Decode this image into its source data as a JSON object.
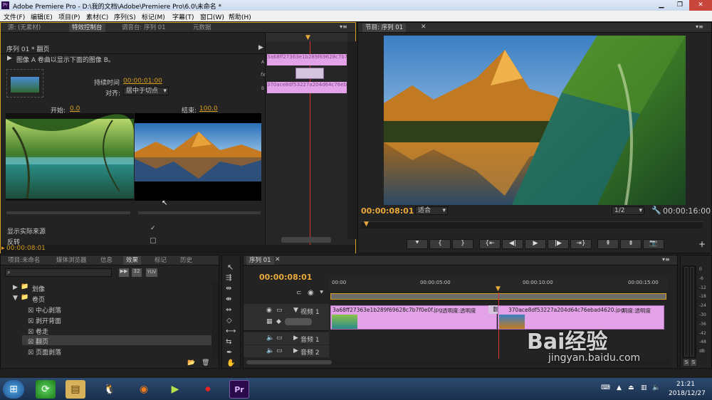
{
  "window": {
    "title": "Adobe Premiere Pro - D:\\我的文档\\Adobe\\Premiere Pro\\6.0\\未命名 *",
    "icon": "Pr"
  },
  "menu": [
    "文件(F)",
    "编辑(E)",
    "项目(P)",
    "素材(C)",
    "序列(S)",
    "标记(M)",
    "字幕(T)",
    "窗口(W)",
    "帮助(H)"
  ],
  "effect_panel": {
    "tabs": [
      "源: (无素材)",
      "特效控制台",
      "调音台: 序列 01",
      "元数据"
    ],
    "sequence_label": "序列 01 * 翻页",
    "description": "图像 A 卷曲以显示下面的图像 B。",
    "duration_label": "持续时间",
    "duration_value": "00:00:01:00",
    "align_label": "对齐:",
    "align_value": "居中于切点",
    "start_label": "开始:",
    "start_value": "0.0",
    "end_label": "结束:",
    "end_value": "100.0",
    "show_source_label": "显示实际来源",
    "reverse_label": "反转",
    "timecode": "00:00:08:01",
    "clip_a_name": "3a68ff27363e1b289f69628c7b7f0e0f.jpg",
    "clip_b_name": "370ace8df53227a204d64c76ebad4620.jpg",
    "label_a": "A",
    "label_b": "B",
    "fx": "fx"
  },
  "program_monitor": {
    "tab": "节目: 序列 01",
    "timecode": "00:00:08:01",
    "fit": "适合",
    "resolution": "1/2",
    "duration": "00:00:16:00"
  },
  "project_panel": {
    "tabs": [
      "项目:未命名",
      "媒体浏览器",
      "信息",
      "效果",
      "标记",
      "历史"
    ],
    "badges": [
      "32",
      "YUV"
    ],
    "folders": [
      {
        "name": "划像",
        "expanded": false
      },
      {
        "name": "卷页",
        "expanded": true
      }
    ],
    "items": [
      "中心剥落",
      "剥开背面",
      "卷走",
      "翻页",
      "页面剥落"
    ],
    "selected": "翻页"
  },
  "timeline": {
    "tab": "序列 01",
    "timecode": "00:00:08:01",
    "ruler": [
      "00:00",
      "00:00:05:00",
      "00:00:10:00",
      "00:00:15:00"
    ],
    "tracks": [
      {
        "name": "视频 1",
        "type": "video"
      },
      {
        "name": "音频 1",
        "type": "audio"
      },
      {
        "name": "音频 2",
        "type": "audio"
      }
    ],
    "clip1": {
      "name": "3a68ff27363e1b289f69628c7b7f0e0f.jpg",
      "fx": "透明度:透明度"
    },
    "transition": "翻页",
    "clip2": {
      "name": "370ace8df53227a204d64c76ebad4620.jpg",
      "fx": "明度:透明度"
    }
  },
  "audio_meter": {
    "ticks": [
      "0",
      "-6",
      "-12",
      "-18",
      "-24",
      "-30",
      "-36",
      "-42",
      "-48",
      "dB"
    ],
    "solo": [
      "S",
      "S"
    ]
  },
  "taskbar": {
    "time": "21:21",
    "date": "2018/12/27",
    "pr_label": "Pr"
  },
  "watermark": {
    "brand": "Bai经验",
    "url": "jingyan.baidu.com"
  }
}
